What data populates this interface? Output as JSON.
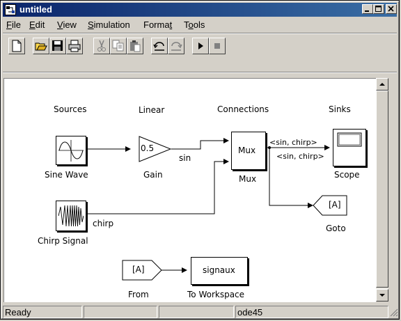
{
  "window": {
    "title": "untitled"
  },
  "menu": {
    "file": {
      "pre": "",
      "key": "F",
      "post": "ile"
    },
    "edit": {
      "pre": "",
      "key": "E",
      "post": "dit"
    },
    "view": {
      "pre": "",
      "key": "V",
      "post": "iew"
    },
    "simulation": {
      "pre": "",
      "key": "S",
      "post": "imulation"
    },
    "format": {
      "pre": "Forma",
      "key": "t",
      "post": ""
    },
    "tools": {
      "pre": "T",
      "key": "o",
      "post": "ols"
    }
  },
  "diagram": {
    "headers": {
      "sources": "Sources",
      "linear": "Linear",
      "connections": "Connections",
      "sinks": "Sinks"
    },
    "blocks": {
      "sine_wave": "Sine Wave",
      "gain": "Gain",
      "gain_value": "0.5",
      "mux": "Mux",
      "mux_label": "Mux",
      "scope": "Scope",
      "chirp": "Chirp Signal",
      "goto": "Goto",
      "goto_tag": "[A]",
      "from": "From",
      "from_tag": "[A]",
      "to_workspace": "To Workspace",
      "workspace_var": "signaux"
    },
    "signals": {
      "sin": "sin",
      "chirp": "chirp",
      "mux_out_top": "<sin, chirp>",
      "mux_out_bottom": "<sin, chirp>"
    }
  },
  "status": {
    "state": "Ready",
    "solver": "ode45"
  }
}
